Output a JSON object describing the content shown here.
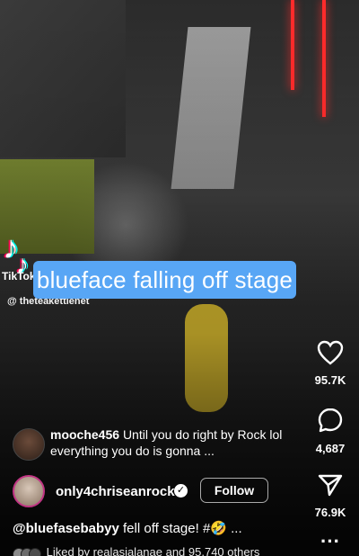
{
  "overlay": {
    "banner_text": "blueface falling off stage",
    "watermark_brand": "TikTok",
    "watermark_handle": "@ theteakettlenet"
  },
  "rail": {
    "likes": "95.7K",
    "comments": "4,687",
    "shares": "76.9K"
  },
  "top_comment": {
    "username": "mooche456",
    "text": "Until you do right by Rock lol everything you do is gonna ..."
  },
  "account": {
    "username": "only4chriseanrock",
    "follow_label": "Follow"
  },
  "caption": {
    "mention": "@bluefasebabyy",
    "text": " fell off stage! #🤣 ..."
  },
  "liked_by": {
    "text": "Liked by realasialanae and 95,740 others"
  }
}
